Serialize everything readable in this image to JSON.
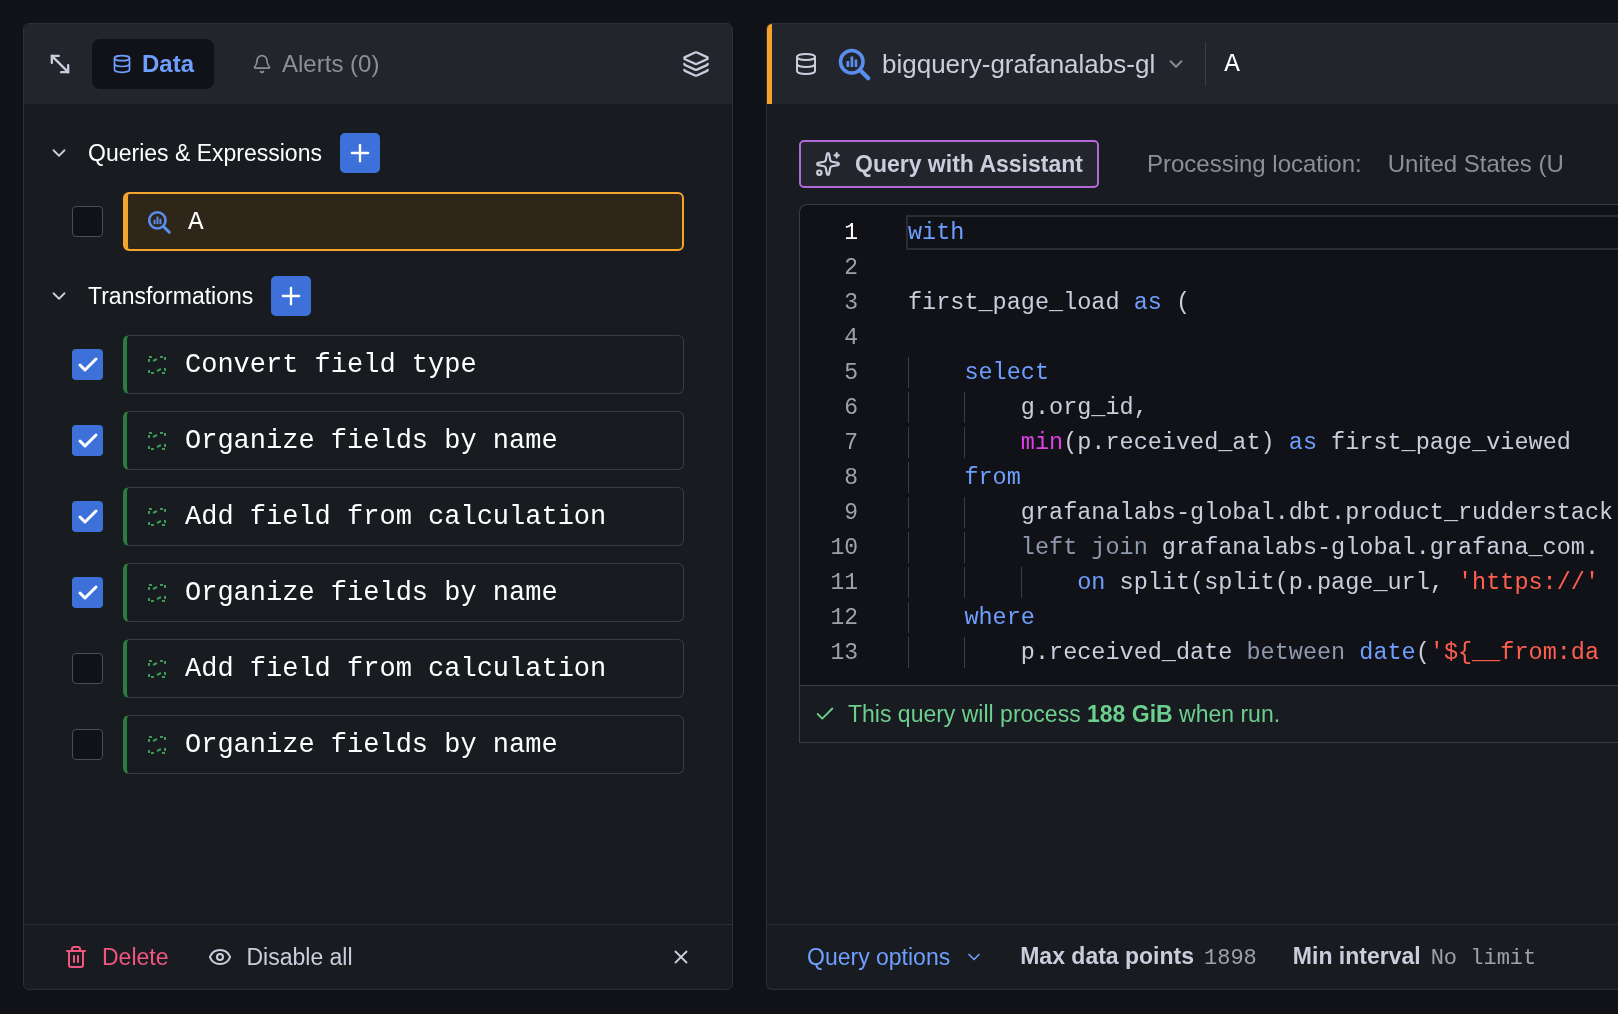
{
  "left_panel": {
    "tabs": [
      {
        "label": "Data",
        "selected": true
      },
      {
        "label": "Alerts (0)",
        "selected": false
      }
    ],
    "sections": [
      {
        "title": "Queries & Expressions",
        "expanded": true,
        "kind": "query",
        "items": [
          {
            "name": "A",
            "checked": false,
            "selected": true
          }
        ]
      },
      {
        "title": "Transformations",
        "expanded": true,
        "kind": "transformation",
        "items": [
          {
            "name": "Convert field type",
            "checked": true,
            "selected": false
          },
          {
            "name": "Organize fields by name",
            "checked": true,
            "selected": false
          },
          {
            "name": "Add field from calculation",
            "checked": true,
            "selected": false
          },
          {
            "name": "Organize fields by name",
            "checked": true,
            "selected": false
          },
          {
            "name": "Add field from calculation",
            "checked": false,
            "selected": false
          },
          {
            "name": "Organize fields by name",
            "checked": false,
            "selected": false
          }
        ]
      }
    ],
    "footer": {
      "delete": "Delete",
      "disable_all": "Disable all"
    }
  },
  "right_panel": {
    "datasource": "bigquery-grafanalabs-gl",
    "query_name": "A",
    "assistant_button": "Query with Assistant",
    "processing_label": "Processing location:",
    "processing_value": "United States (U",
    "code_lines": [
      {
        "number": "1",
        "current": true,
        "tokens": [
          {
            "kind": "keyword",
            "text": "with"
          }
        ]
      },
      {
        "number": "2",
        "current": false
      },
      {
        "number": "3",
        "current": false,
        "tokens": [
          {
            "kind": "plain",
            "text": "first_page_load "
          },
          {
            "kind": "keyword",
            "text": "as"
          },
          {
            "kind": "plain",
            "text": " ("
          }
        ]
      },
      {
        "number": "4",
        "current": false
      },
      {
        "number": "5",
        "current": false,
        "tokens": [
          {
            "kind": "keyword",
            "text": "    select"
          }
        ]
      },
      {
        "number": "6",
        "current": false,
        "tokens": [
          {
            "kind": "plain",
            "text": "        g.org_id,"
          }
        ]
      },
      {
        "number": "7",
        "current": false,
        "tokens": [
          {
            "kind": "function",
            "text": "        min"
          },
          {
            "kind": "plain",
            "text": "(p.received_at) "
          },
          {
            "kind": "keyword",
            "text": "as"
          },
          {
            "kind": "plain",
            "text": " first_page_viewed"
          }
        ]
      },
      {
        "number": "8",
        "current": false,
        "tokens": [
          {
            "kind": "keyword",
            "text": "    from"
          }
        ]
      },
      {
        "number": "9",
        "current": false,
        "tokens": [
          {
            "kind": "plain",
            "text": "        grafanalabs-global.dbt.product_rudderstack"
          }
        ]
      },
      {
        "number": "10",
        "current": false,
        "tokens": [
          {
            "kind": "muted",
            "text": "        left join"
          },
          {
            "kind": "plain",
            "text": " grafanalabs-global.grafana_com."
          }
        ]
      },
      {
        "number": "11",
        "current": false,
        "tokens": [
          {
            "kind": "keyword",
            "text": "            on"
          },
          {
            "kind": "plain",
            "text": " split(split(p.page_url, "
          },
          {
            "kind": "string",
            "text": "'https://'"
          }
        ]
      },
      {
        "number": "12",
        "current": false,
        "tokens": [
          {
            "kind": "keyword",
            "text": "    where"
          }
        ]
      },
      {
        "number": "13",
        "current": false,
        "tokens": [
          {
            "kind": "plain",
            "text": "        p.received_date "
          },
          {
            "kind": "muted",
            "text": "between"
          },
          {
            "kind": "keyword",
            "text": " date"
          },
          {
            "kind": "plain",
            "text": "("
          },
          {
            "kind": "string",
            "text": "'${__from:da"
          }
        ]
      }
    ],
    "validation": "This query will process **188 GiB** when run.",
    "footer": {
      "query_options": "Query options",
      "max_points_label": "Max data points",
      "max_points_value": "1898",
      "min_interval_label": "Min interval",
      "min_interval_value": "No limit"
    }
  }
}
